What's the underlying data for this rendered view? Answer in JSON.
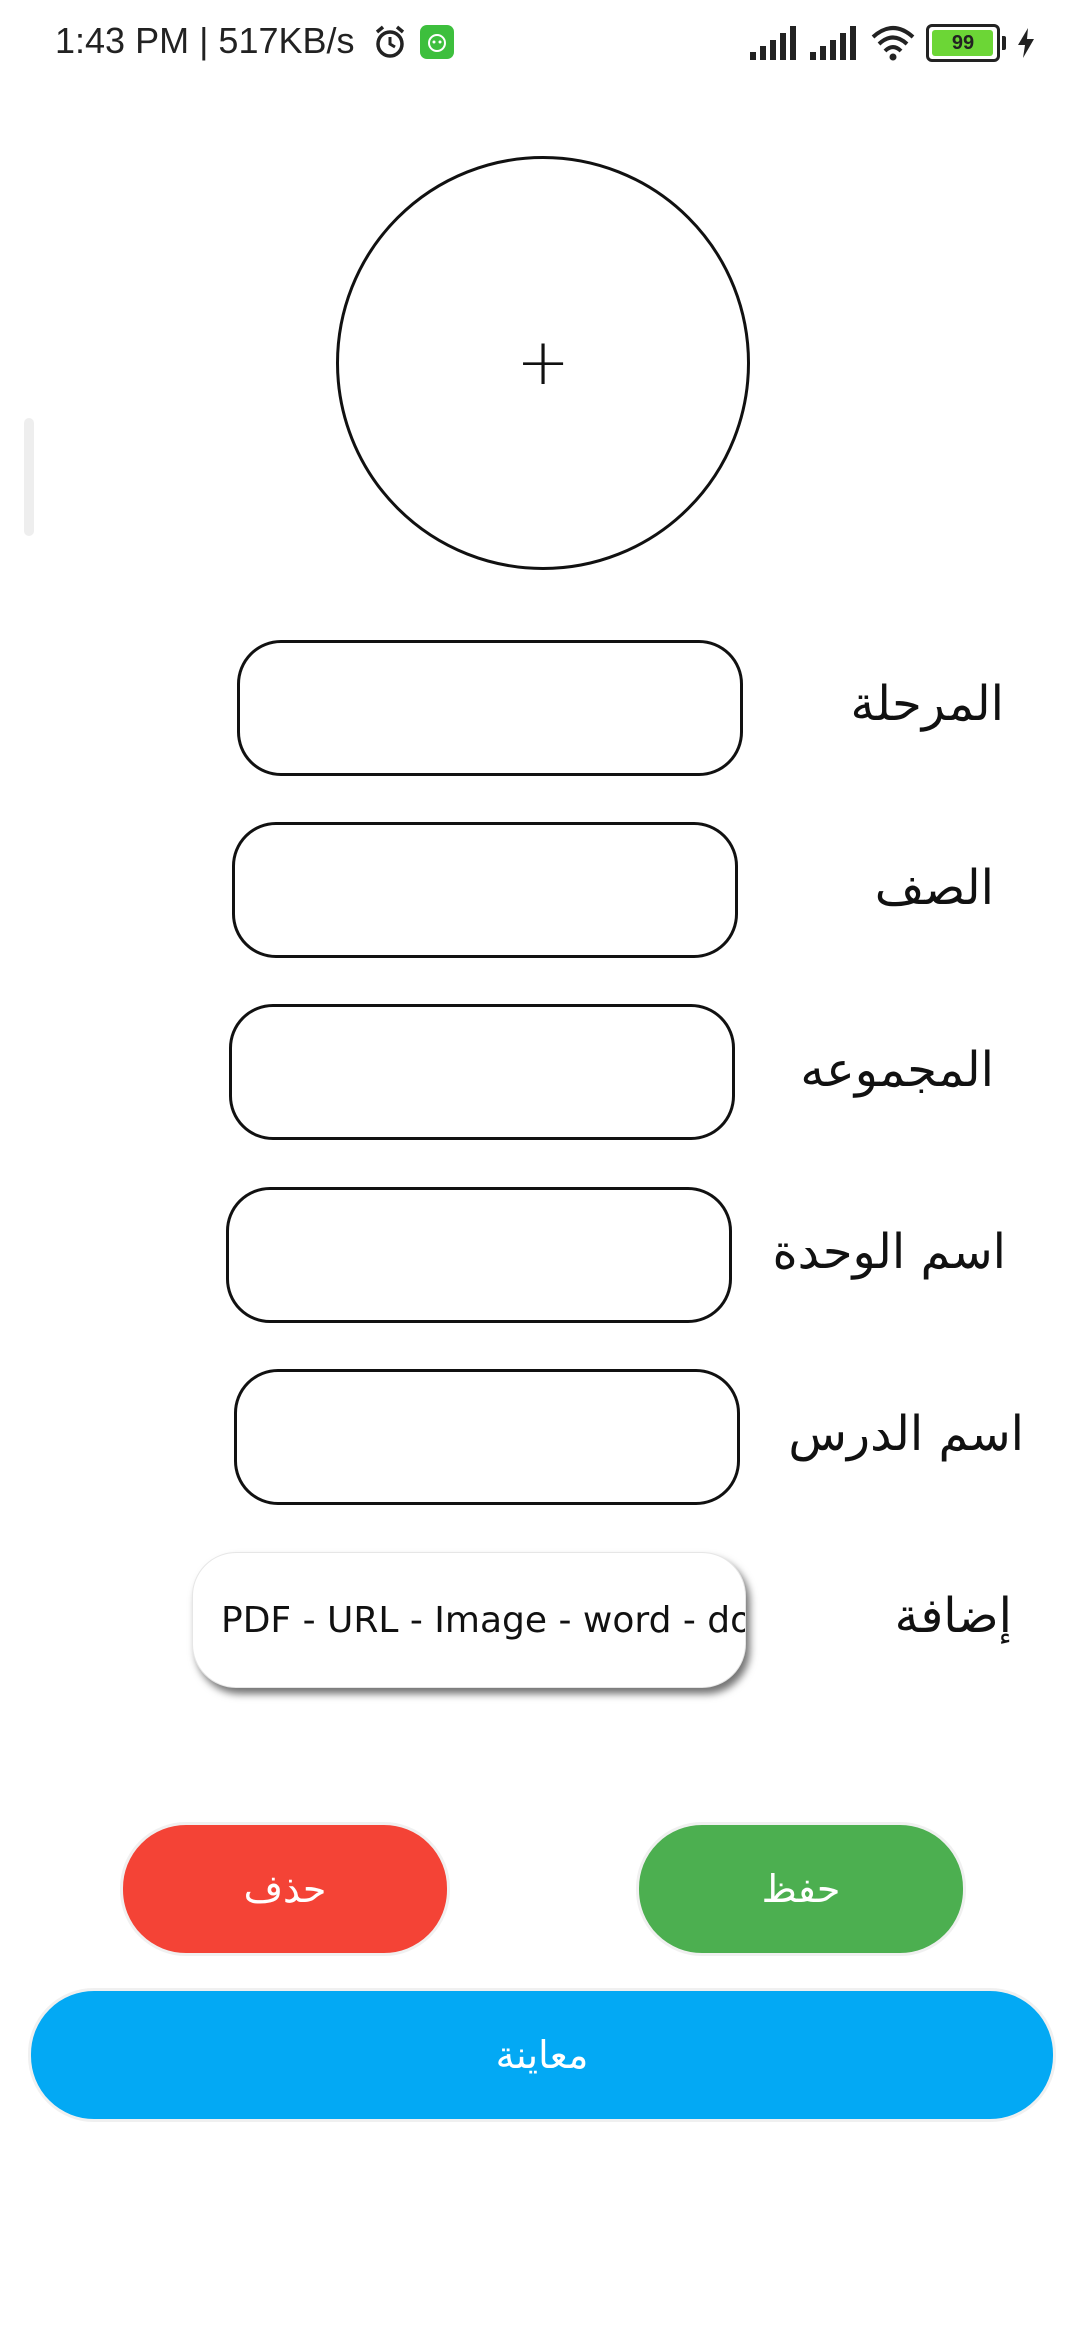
{
  "status_bar": {
    "time": "1:43 PM | 517KB/s",
    "battery": "99",
    "icons": [
      "alarm-icon",
      "app-notification-icon",
      "signal-icon",
      "signal-icon",
      "wifi-icon",
      "battery-icon",
      "charging-icon"
    ]
  },
  "image_picker": {
    "icon": "plus-icon",
    "symbol": "+"
  },
  "form": {
    "stage_label": "المرحلة",
    "grade_label": "الصف",
    "group_label": "المجموعه",
    "unit_label": "اسم الوحدة",
    "lesson_label": "اسم الدرس",
    "attach_label": "إضافة",
    "attach_value": "PDF - URL - Image - word - doc"
  },
  "buttons": {
    "save": "حفظ",
    "delete": "حذف",
    "preview": "معاينة"
  },
  "colors": {
    "save": "#4caf50",
    "delete": "#f44336",
    "preview": "#03a9f4",
    "battery": "#6cd636"
  }
}
